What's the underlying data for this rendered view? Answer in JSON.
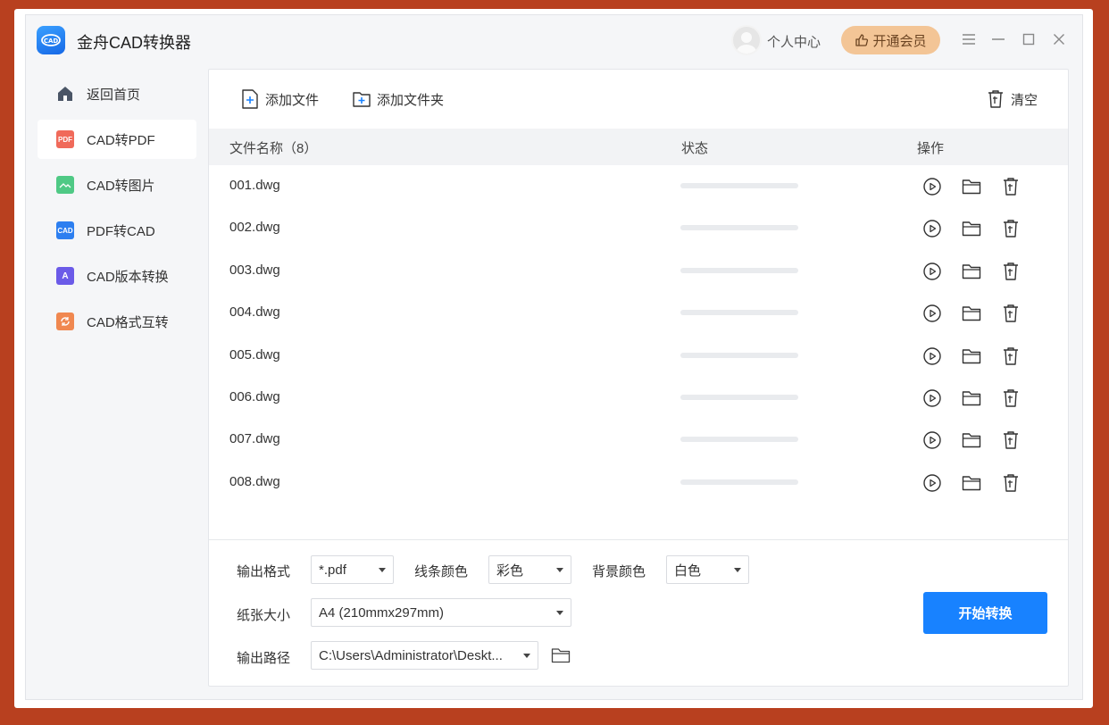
{
  "app": {
    "title": "金舟CAD转换器",
    "user_center": "个人中心",
    "vip_label": "开通会员",
    "accent_color": "#1882ff"
  },
  "sidebar": {
    "items": [
      {
        "label": "返回首页",
        "icon": "home-icon",
        "active": false
      },
      {
        "label": "CAD转PDF",
        "icon": "pdf-icon",
        "active": true
      },
      {
        "label": "CAD转图片",
        "icon": "image-icon",
        "active": false
      },
      {
        "label": "PDF转CAD",
        "icon": "cad-icon",
        "active": false
      },
      {
        "label": "CAD版本转换",
        "icon": "version-icon",
        "active": false
      },
      {
        "label": "CAD格式互转",
        "icon": "format-convert-icon",
        "active": false
      }
    ]
  },
  "toolbar": {
    "add_file": "添加文件",
    "add_folder": "添加文件夹",
    "clear": "清空"
  },
  "table": {
    "headers": {
      "name": "文件名称（8）",
      "status": "状态",
      "actions": "操作"
    },
    "rows": [
      {
        "name": "001.dwg",
        "progress": 0
      },
      {
        "name": "002.dwg",
        "progress": 0
      },
      {
        "name": "003.dwg",
        "progress": 0
      },
      {
        "name": "004.dwg",
        "progress": 0
      },
      {
        "name": "005.dwg",
        "progress": 0
      },
      {
        "name": "006.dwg",
        "progress": 0
      },
      {
        "name": "007.dwg",
        "progress": 0
      },
      {
        "name": "008.dwg",
        "progress": 0
      }
    ]
  },
  "options": {
    "output_format_label": "输出格式",
    "output_format": "*.pdf",
    "line_color_label": "线条颜色",
    "line_color": "彩色",
    "bg_color_label": "背景颜色",
    "bg_color": "白色",
    "paper_size_label": "纸张大小",
    "paper_size": "A4 (210mmx297mm)",
    "output_path_label": "输出路径",
    "output_path": "C:\\Users\\Administrator\\Deskt..."
  },
  "start_button": "开始转换"
}
